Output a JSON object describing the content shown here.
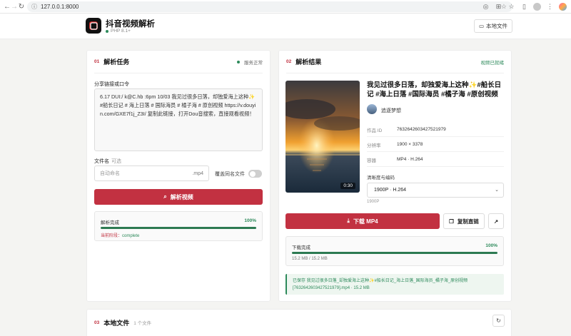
{
  "browser": {
    "url": "127.0.0.1:8000"
  },
  "header": {
    "app_title": "抖音视频解析",
    "php_version": "PHP 8.1+",
    "local_files_label": "本地文件"
  },
  "parse_card": {
    "num": "01",
    "title": "解析任务",
    "status": "服务正常",
    "share_label": "分享链接或口令",
    "share_text": "6.17 DUI:/ k@C.hb :6pm 10/03 我见过很多日落，却独爱海上这种✨#船长日记 # 海上日落 # 国际海员 # 橘子海 # 原创视频 https://v.douyin.com/GXE7f1j_Z3I/ 复制此链接，打开Dou音搜索，直接观看视频！",
    "filename_label": "文件名",
    "filename_optional": "可选",
    "filename_placeholder": "自动命名",
    "filename_ext": ".mp4",
    "overwrite_label": "覆盖同名文件",
    "overwrite_on": false,
    "parse_button": "解析视频",
    "progress_label": "解析完成",
    "progress_pct": "100%",
    "progress_value": 1.0,
    "stage_key": "当前阶段：",
    "stage_value": "complete"
  },
  "result_card": {
    "num": "02",
    "title": "解析结果",
    "status": "视频已就绪",
    "duration": "0:30",
    "video_title": "我见过很多日落，却独爱海上这种✨#船长日记 #海上日落 #国际海员 #橘子海 #原创视频",
    "author": "追逐梦想",
    "meta": [
      {
        "key": "作品 ID",
        "value": "7632642603427521979"
      },
      {
        "key": "分辨率",
        "value": "1900 × 3378"
      },
      {
        "key": "容器",
        "value": "MP4 · H.264"
      }
    ],
    "quality_label": "清晰度与编码",
    "quality_selected": "1900P · H.264",
    "quality_sub": "1900P",
    "download_button": "下载 MP4",
    "copy_button": "复制直链",
    "download_progress_label": "下载完成",
    "download_progress_pct": "100%",
    "download_progress_value": 1.0,
    "download_size": "15.2 MB / 15.2 MB",
    "saved_note": "已保存 我见过很多日落_却独爱海上这种✨#船长日记_海上日落_国际海员_橘子海_原创视频 [7632642603427521979].mp4 · 15.2 MB"
  },
  "files_card": {
    "num": "03",
    "title": "本地文件",
    "count": "1 个文件"
  }
}
